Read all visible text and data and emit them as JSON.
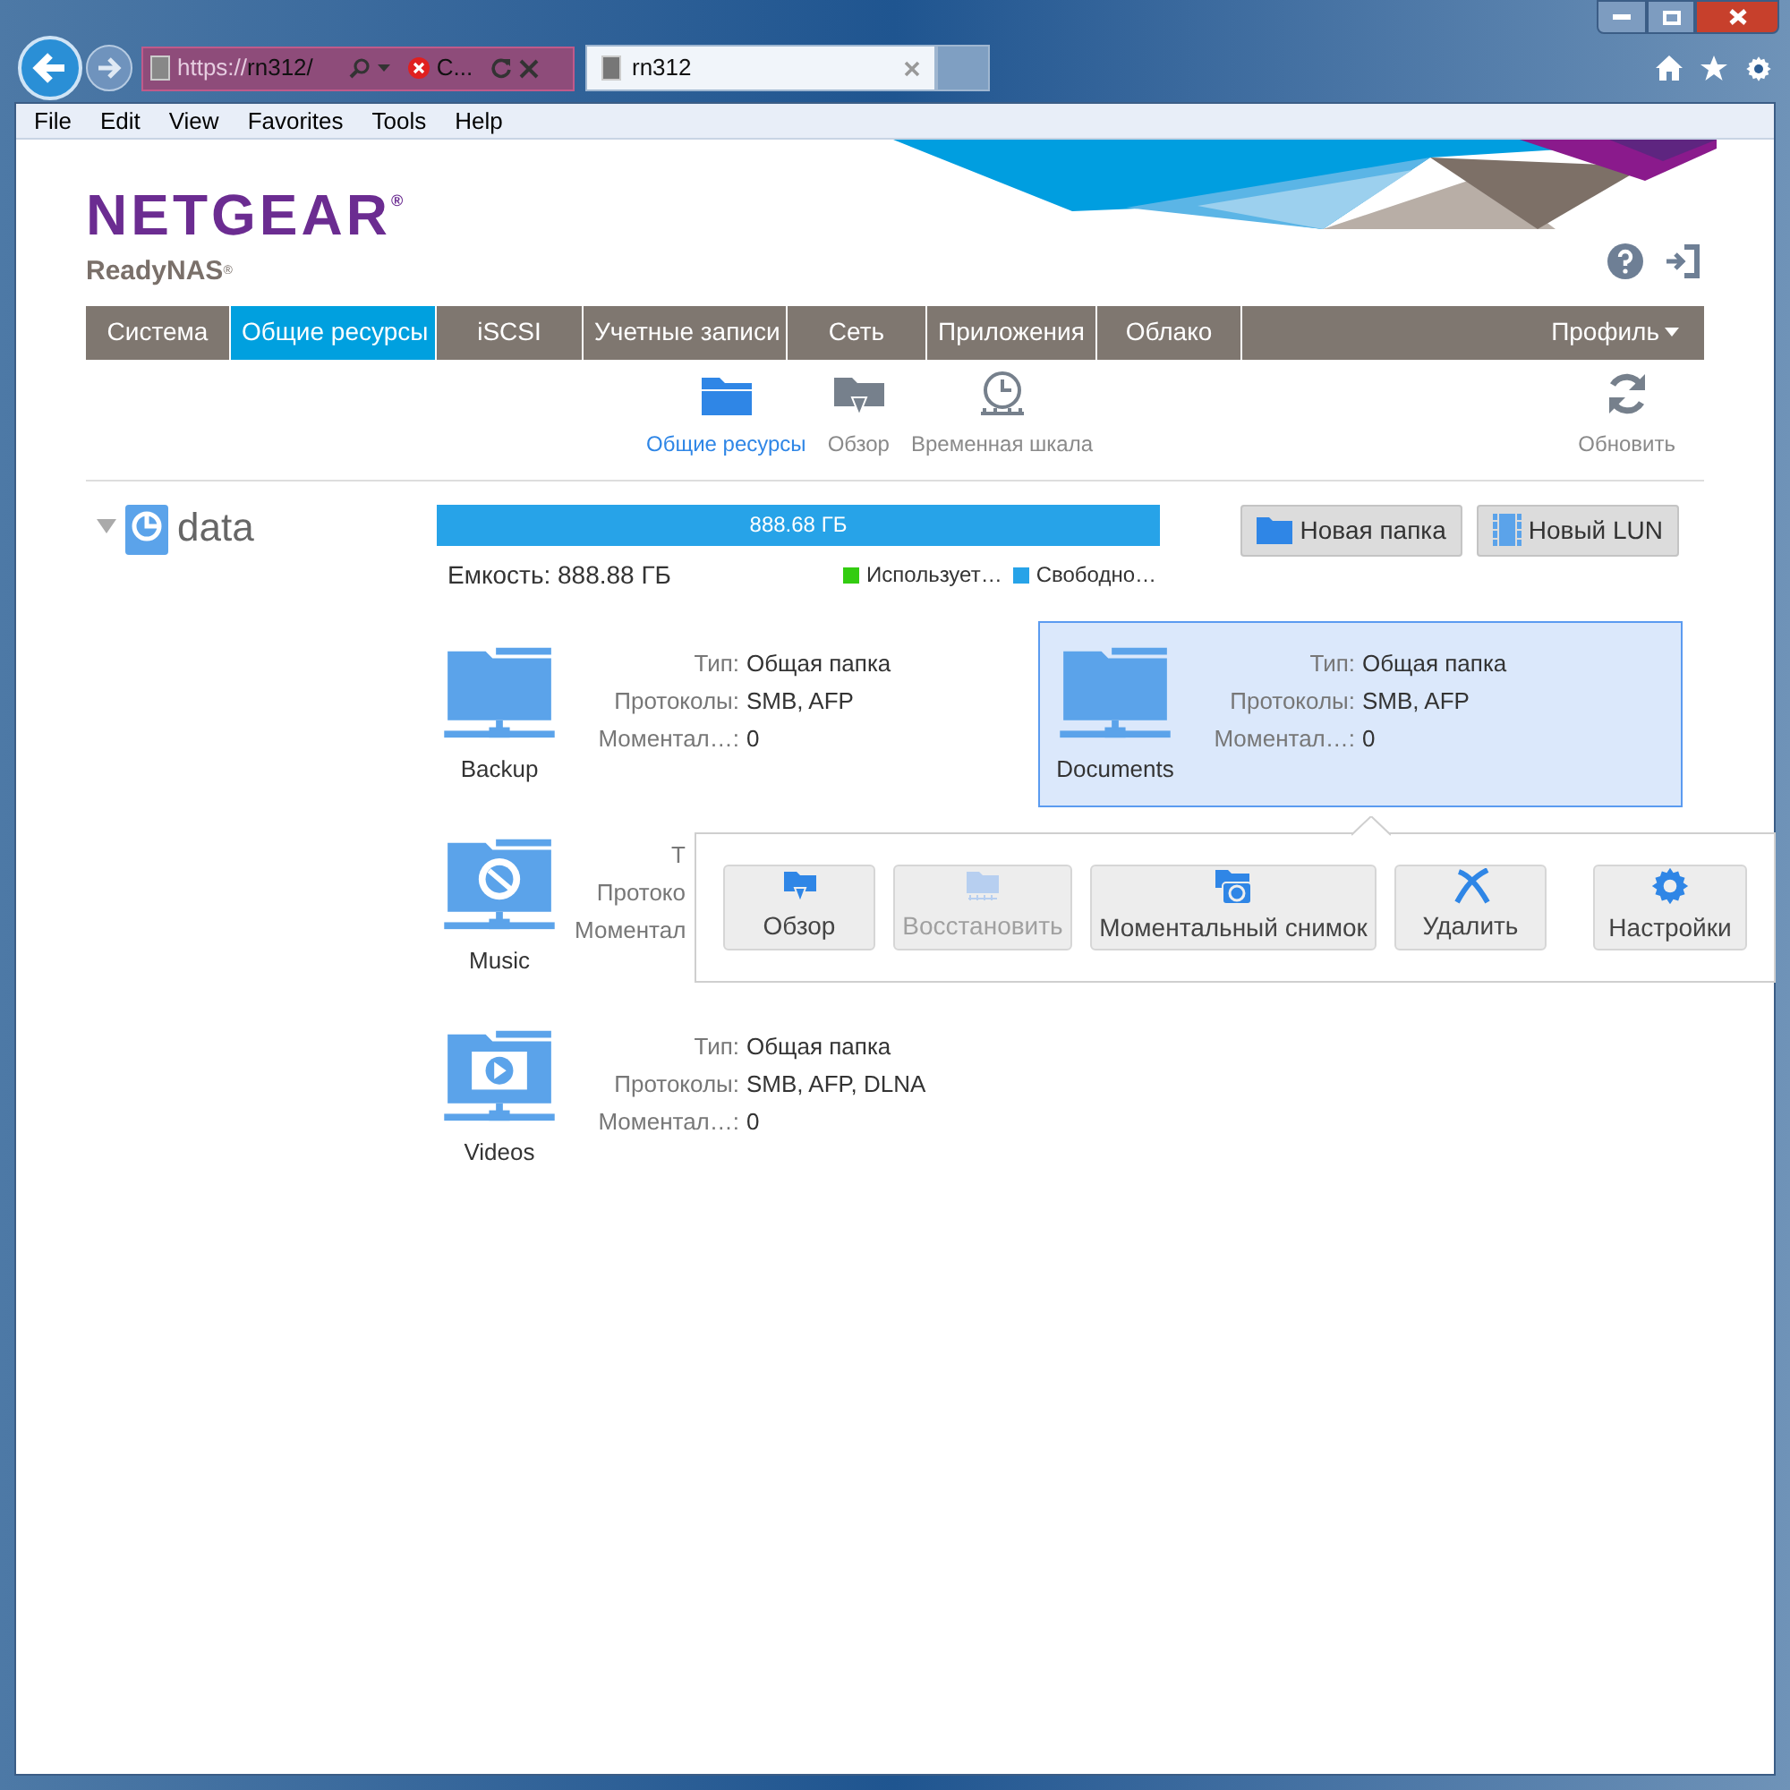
{
  "browser": {
    "address_prefix": "https://",
    "address": "rn312/",
    "cert_error": "C...",
    "tab_title": "rn312",
    "menu": [
      "File",
      "Edit",
      "View",
      "Favorites",
      "Tools",
      "Help"
    ]
  },
  "header": {
    "brand": "NETGEAR",
    "brand_mark": "®",
    "product": "ReadyNAS",
    "product_mark": "®"
  },
  "nav": {
    "tabs": [
      {
        "label": "Система",
        "selected": false
      },
      {
        "label": "Общие ресурсы",
        "selected": true
      },
      {
        "label": "iSCSI",
        "selected": false
      },
      {
        "label": "Учетные записи",
        "selected": false
      },
      {
        "label": "Сеть",
        "selected": false
      },
      {
        "label": "Приложения",
        "selected": false
      },
      {
        "label": "Облако",
        "selected": false
      }
    ],
    "profile": "Профиль"
  },
  "subnav": {
    "items": [
      {
        "label": "Общие ресурсы",
        "selected": true
      },
      {
        "label": "Обзор",
        "selected": false
      },
      {
        "label": "Временная шкала",
        "selected": false
      }
    ],
    "refresh": "Обновить"
  },
  "volume": {
    "name": "data",
    "expanded": true,
    "bar_label": "888.68 ГБ",
    "level": 1,
    "capacity": "Емкость: 888.88 ГБ",
    "legend": [
      {
        "label": "Использует…",
        "color": "#33cc11"
      },
      {
        "label": "Свободно…",
        "color": "#27a3e8"
      }
    ]
  },
  "actions": [
    "Новая папка",
    "Новый LUN"
  ],
  "shares": [
    {
      "name": "Backup",
      "kind": "folder",
      "selected": false,
      "fields": [
        {
          "label": "Тип:",
          "value": "Общая папка"
        },
        {
          "label": "Протоколы:",
          "value": "SMB, AFP"
        },
        {
          "label": "Моментал…:",
          "value": "0"
        }
      ]
    },
    {
      "name": "Documents",
      "kind": "folder",
      "selected": true,
      "fields": [
        {
          "label": "Тип:",
          "value": "Общая папка"
        },
        {
          "label": "Протоколы:",
          "value": "SMB, AFP"
        },
        {
          "label": "Моментал…:",
          "value": "0"
        }
      ]
    },
    {
      "name": "Music",
      "kind": "music",
      "selected": false,
      "fields": [
        {
          "label": "Т"
        },
        {
          "label": "Протоко"
        },
        {
          "label": "Моментал"
        }
      ]
    },
    {
      "name": "Videos",
      "kind": "video",
      "selected": false,
      "fields": [
        {
          "label": "Тип:",
          "value": "Общая папка"
        },
        {
          "label": "Протоколы:",
          "value": "SMB, AFP, DLNA"
        },
        {
          "label": "Моментал…:",
          "value": "0"
        }
      ]
    }
  ],
  "popup": {
    "buttons": [
      {
        "label": "Обзор",
        "kind": "browse",
        "disabled": false
      },
      {
        "label": "Восстановить",
        "kind": "restore",
        "disabled": true
      },
      {
        "label": "Моментальный снимок",
        "kind": "snapshot",
        "disabled": false
      },
      {
        "label": "Удалить",
        "kind": "delete",
        "disabled": false
      },
      {
        "label": "Настройки",
        "kind": "settings",
        "disabled": false
      }
    ]
  }
}
